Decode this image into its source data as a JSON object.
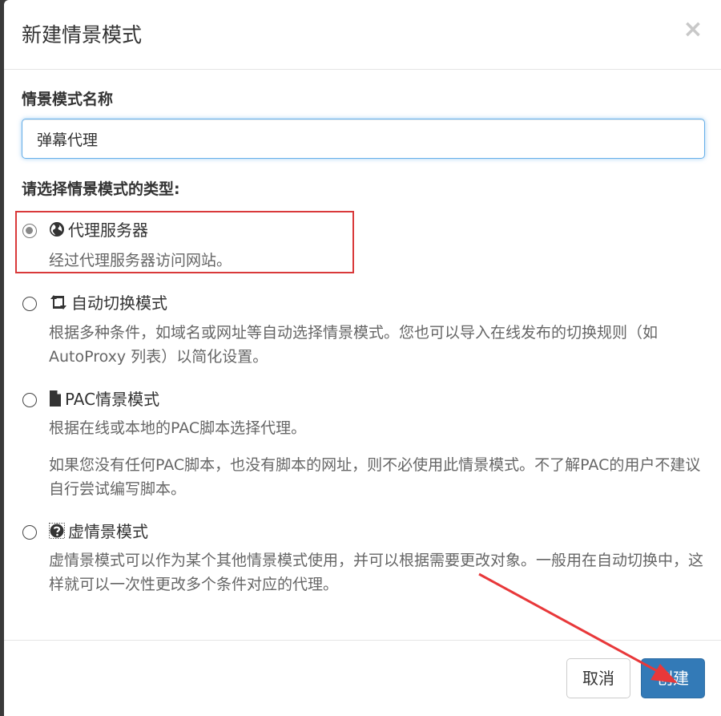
{
  "dialog": {
    "title": "新建情景模式",
    "close_symbol": "×"
  },
  "form": {
    "name_label": "情景模式名称",
    "name_value": "弹幕代理",
    "type_label": "请选择情景模式的类型:"
  },
  "options": [
    {
      "title": "代理服务器",
      "icon": "globe-icon",
      "checked": true,
      "desc": [
        "经过代理服务器访问网站。"
      ]
    },
    {
      "title": "自动切换模式",
      "icon": "retweet-icon",
      "checked": false,
      "desc": [
        "根据多种条件，如域名或网址等自动选择情景模式。您也可以导入在线发布的切换规则（如 AutoProxy 列表）以简化设置。"
      ]
    },
    {
      "title": "PAC情景模式",
      "icon": "file-icon",
      "checked": false,
      "desc": [
        "根据在线或本地的PAC脚本选择代理。",
        "如果您没有任何PAC脚本，也没有脚本的网址，则不必使用此情景模式。不了解PAC的用户不建议自行尝试编写脚本。"
      ]
    },
    {
      "title": "虚情景模式",
      "icon": "question-circle-icon",
      "checked": false,
      "desc": [
        "虚情景模式可以作为某个其他情景模式使用，并可以根据需要更改对象。一般用在自动切换中，这样就可以一次性更改多个条件对应的代理。"
      ]
    }
  ],
  "footer": {
    "cancel_label": "取消",
    "create_label": "创建"
  },
  "colors": {
    "primary": "#337ab7",
    "annotation": "#d9393a",
    "input_focus": "#66afe9"
  }
}
